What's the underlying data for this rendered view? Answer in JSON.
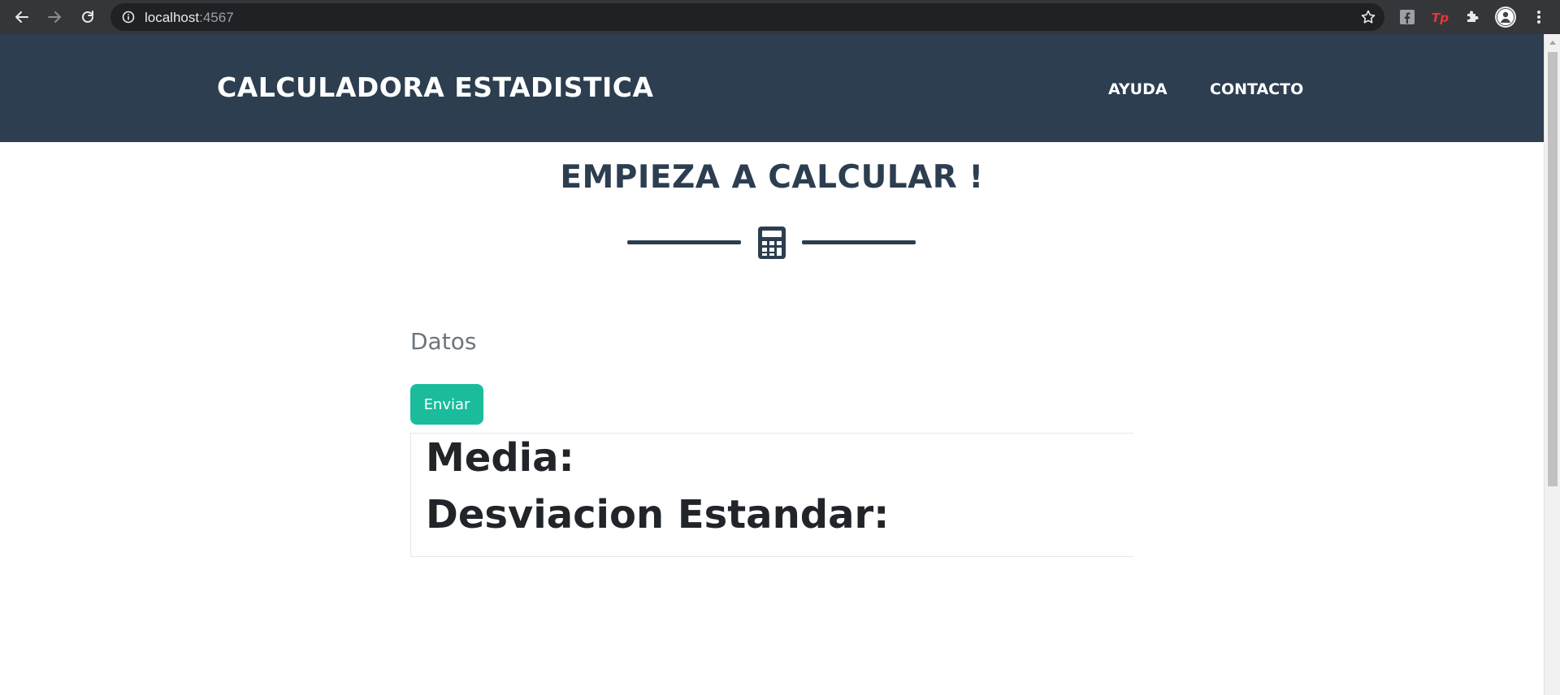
{
  "browser": {
    "url_host": "localhost",
    "url_port": ":4567"
  },
  "navbar": {
    "brand": "CALCULADORA ESTADISTICA",
    "links": [
      "AYUDA",
      "CONTACTO"
    ]
  },
  "main": {
    "heading": "EMPIEZA A CALCULAR !",
    "icon": "calculator-icon",
    "input_label": "Datos",
    "submit_label": "Enviar",
    "results": {
      "mean_label": "Media:",
      "std_label": "Desviacion Estandar:"
    }
  },
  "colors": {
    "primary": "#2c3e50",
    "accent": "#1abc9c",
    "muted": "#6c757d"
  }
}
